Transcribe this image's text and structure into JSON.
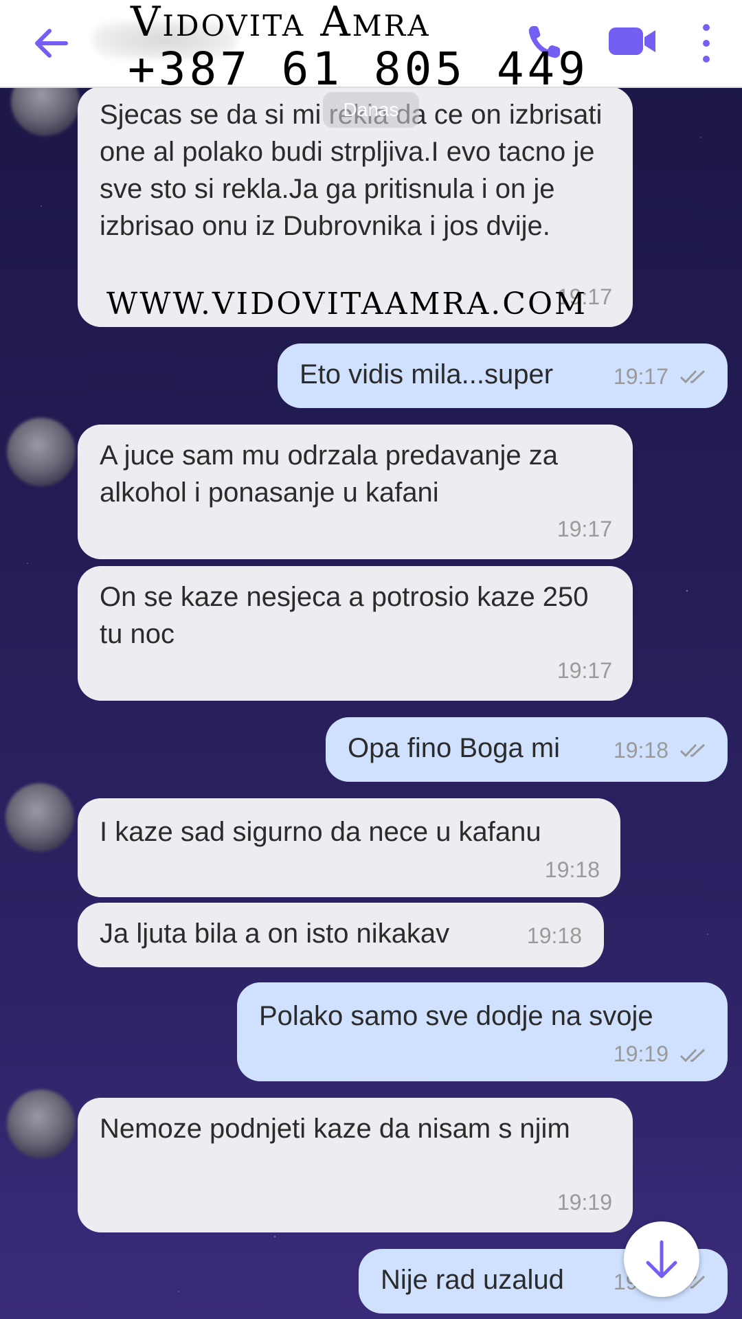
{
  "overlay": {
    "title": "Vidovita Amra",
    "phone": "+387 61 805 449",
    "website": "WWW.VIDOVITAAMRA.COM"
  },
  "header": {
    "date_chip": "Danas",
    "icons": [
      "back-arrow-icon",
      "phone-icon",
      "video-camera-icon",
      "more-vert-icon"
    ],
    "accent_color": "#7360f2"
  },
  "messages": [
    {
      "dir": "in",
      "text": "Sjecas se da si mi rekla da ce on izbrisati one al polako budi strpljiva.I evo tacno je sve sto si rekla.Ja ga pritisnula i on je izbrisao onu iz Dubrovnika i jos dvije.",
      "time": "19:17"
    },
    {
      "dir": "out",
      "text": "Eto vidis mila...super",
      "time": "19:17"
    },
    {
      "dir": "in",
      "text": "A juce sam mu odrzala predavanje za alkohol i ponasanje u kafani",
      "time": "19:17"
    },
    {
      "dir": "in",
      "text": "On se kaze nesjeca a potrosio kaze 250 tu noc",
      "time": "19:17"
    },
    {
      "dir": "out",
      "text": "Opa fino Boga mi",
      "time": "19:18"
    },
    {
      "dir": "in",
      "text": "I kaze sad sigurno da nece u kafanu",
      "time": "19:18"
    },
    {
      "dir": "in",
      "text": "Ja ljuta bila a on isto nikakav",
      "time": "19:18"
    },
    {
      "dir": "out",
      "text": "Polako samo sve dodje na svoje",
      "time": "19:19"
    },
    {
      "dir": "in",
      "text": "Nemoze podnjeti kaze da nisam s njim",
      "time": "19:19"
    },
    {
      "dir": "out",
      "text": "Nije rad uzalud",
      "time": "19:19"
    }
  ],
  "colors": {
    "incoming_bubble": "#ededf1",
    "outgoing_bubble": "#cfe1ff",
    "background": "#241c55"
  }
}
